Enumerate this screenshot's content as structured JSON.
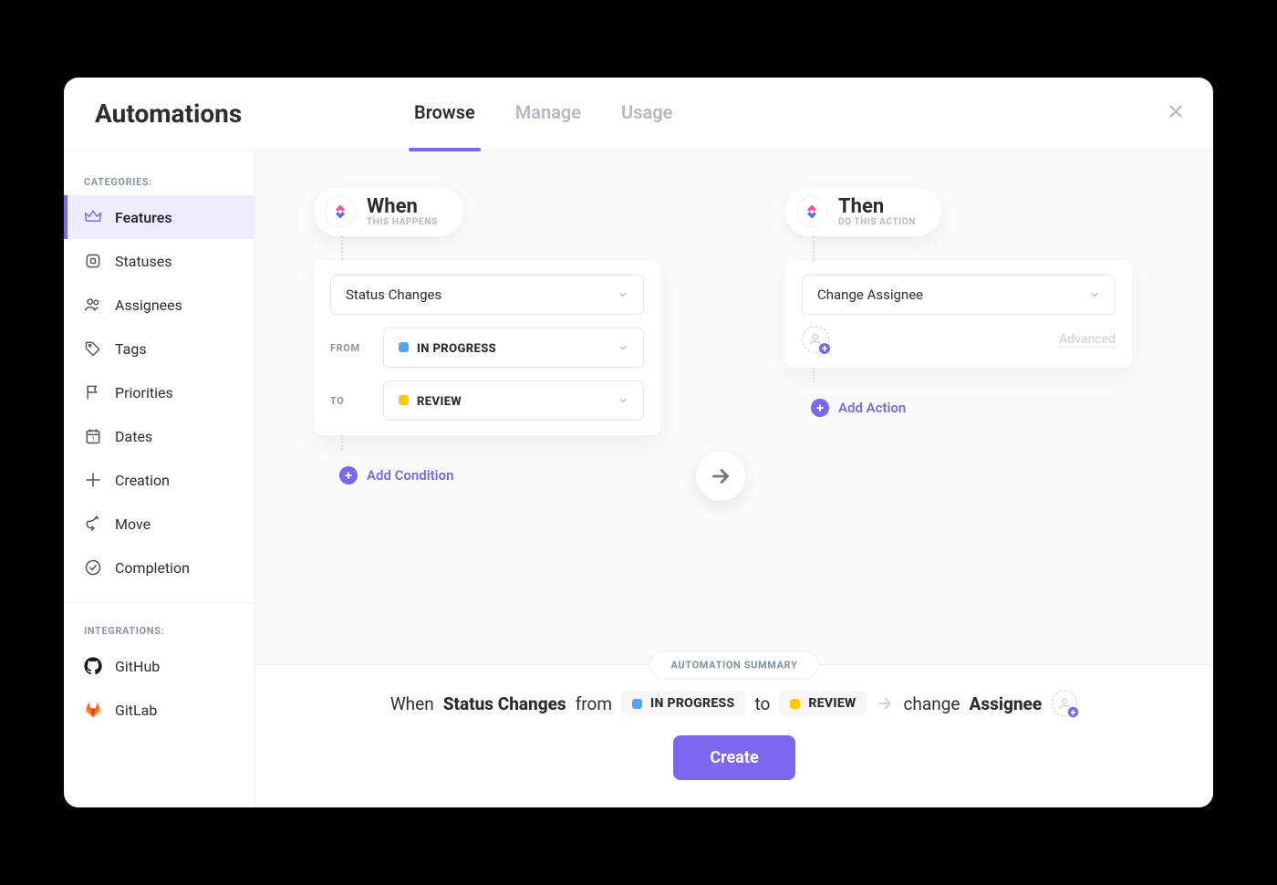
{
  "colors": {
    "accent": "#7B68EE",
    "statusBlue": "#4DA3FF",
    "statusYellow": "#FFC800"
  },
  "header": {
    "title": "Automations",
    "tabs": [
      {
        "label": "Browse",
        "active": true
      },
      {
        "label": "Manage",
        "active": false
      },
      {
        "label": "Usage",
        "active": false
      }
    ]
  },
  "sidebar": {
    "categoriesLabel": "CATEGORIES:",
    "items": [
      {
        "label": "Features",
        "icon": "crown",
        "active": true
      },
      {
        "label": "Statuses",
        "icon": "status"
      },
      {
        "label": "Assignees",
        "icon": "users"
      },
      {
        "label": "Tags",
        "icon": "tag"
      },
      {
        "label": "Priorities",
        "icon": "flag"
      },
      {
        "label": "Dates",
        "icon": "calendar"
      },
      {
        "label": "Creation",
        "icon": "plus"
      },
      {
        "label": "Move",
        "icon": "share"
      },
      {
        "label": "Completion",
        "icon": "check"
      }
    ],
    "integrationsLabel": "INTEGRATIONS:",
    "integrations": [
      {
        "label": "GitHub",
        "icon": "github"
      },
      {
        "label": "GitLab",
        "icon": "gitlab"
      }
    ]
  },
  "when": {
    "title": "When",
    "subtitle": "THIS HAPPENS",
    "triggerLabel": "Status Changes",
    "fromLabel": "FROM",
    "fromStatus": "IN PROGRESS",
    "toLabel": "TO",
    "toStatus": "REVIEW",
    "addConditionLabel": "Add Condition"
  },
  "then": {
    "title": "Then",
    "subtitle": "DO THIS ACTION",
    "actionLabel": "Change Assignee",
    "advancedLabel": "Advanced",
    "addActionLabel": "Add Action"
  },
  "summary": {
    "badge": "AUTOMATION SUMMARY",
    "whenWord": "When",
    "triggerBold": "Status Changes",
    "fromWord": "from",
    "fromStatus": "IN PROGRESS",
    "toWord": "to",
    "toStatus": "REVIEW",
    "changeWord": "change",
    "actionBold": "Assignee",
    "createLabel": "Create"
  }
}
